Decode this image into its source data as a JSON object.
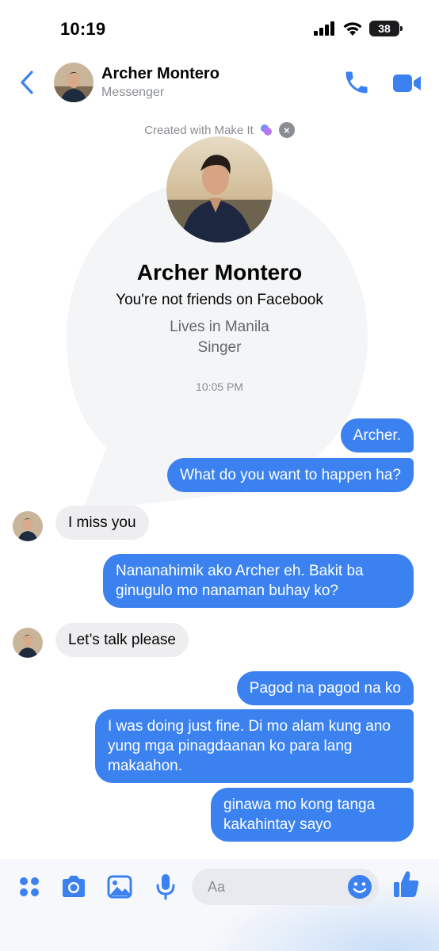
{
  "status_bar": {
    "time": "10:19",
    "battery": "38"
  },
  "header": {
    "name": "Archer Montero",
    "subtitle": "Messenger"
  },
  "profile": {
    "made_with": "Created with Make It",
    "name": "Archer Montero",
    "friends_status": "You're not friends on Facebook",
    "location": "Lives in Manila",
    "occupation": "Singer"
  },
  "thread": {
    "timestamp": "10:05 PM",
    "messages": [
      {
        "side": "out",
        "text": "Archer."
      },
      {
        "side": "out",
        "text": "What do you want to happen ha?"
      },
      {
        "side": "in",
        "text": "I miss you"
      },
      {
        "side": "out",
        "text": "Nananahimik ako Archer eh. Bakit ba ginugulo mo nanaman buhay ko?"
      },
      {
        "side": "in",
        "text": "Let’s talk please"
      },
      {
        "side": "out",
        "text": "Pagod na pagod na ko"
      },
      {
        "side": "out",
        "text": "I was doing just fine. Di mo alam kung ano yung mga pinagdaanan ko para lang makaahon."
      },
      {
        "side": "out",
        "text": "ginawa mo kong tanga kakahintay sayo"
      }
    ]
  },
  "composer": {
    "placeholder": "Aa"
  },
  "icons": {
    "back": "chevron-left-icon",
    "call": "phone-icon",
    "video": "video-camera-icon",
    "close": "close-icon",
    "apps": "four-dots-icon",
    "camera": "camera-icon",
    "gallery": "image-icon",
    "mic": "microphone-icon",
    "emoji": "smiley-icon",
    "like": "thumbs-up-icon"
  },
  "colors": {
    "accent": "#3b82f0",
    "incoming_bubble": "#eeeef0",
    "secondary_text": "#8a8d91"
  }
}
